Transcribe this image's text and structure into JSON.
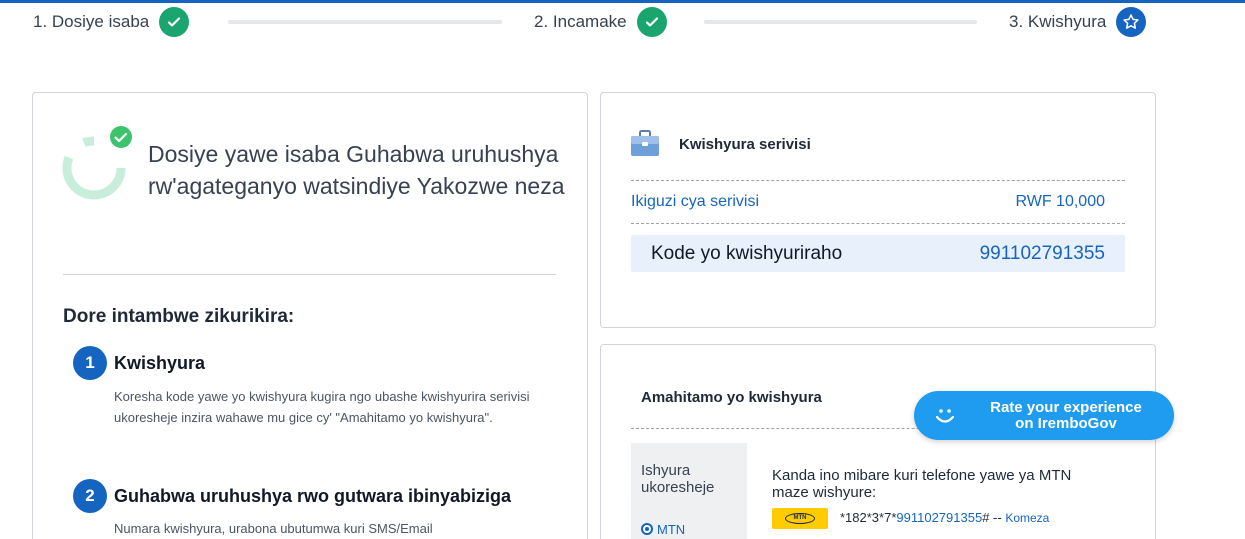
{
  "stepper": {
    "steps": [
      {
        "label": "1. Dosiye isaba",
        "status": "completed",
        "icon": "check-icon"
      },
      {
        "label": "2. Incamake",
        "status": "completed",
        "icon": "check-icon"
      },
      {
        "label": "3. Kwishyura",
        "status": "current",
        "icon": "star-icon"
      }
    ]
  },
  "success": {
    "title": "Dosiye yawe isaba Guhabwa uruhushya rw'agateganyo watsindiye Yakozwe neza",
    "icon": "success-check-icon"
  },
  "next_steps": {
    "heading": "Dore intambwe zikurikira:",
    "items": [
      {
        "number": "1",
        "title": "Kwishyura",
        "description": "Koresha kode yawe yo kwishyura kugira ngo ubashe kwishyurira serivisi ukoresheje inzira wahawe mu gice cy' \"Amahitamo yo kwishyura\"."
      },
      {
        "number": "2",
        "title": "Guhabwa uruhushya rwo gutwara ibinyabiziga",
        "description": "Numara kwishyura, urabona ubutumwa kuri SMS/Email"
      }
    ]
  },
  "payment": {
    "heading": "Kwishyura serivisi",
    "icon": "briefcase-icon",
    "fee_label": "Ikiguzi cya serivisi",
    "fee_value": "RWF 10,000",
    "code_label": "Kode yo kwishyuriraho",
    "code_value": "991102791355"
  },
  "payment_options": {
    "heading": "Amahitamo yo kwishyura",
    "method_label": "Ishyura ukoresheje",
    "selected_method": "MTN",
    "instruction": "Kanda ino mibare kuri telefone yawe ya MTN maze wishyure:",
    "logo_text": "MTN",
    "ussd_prefix": "*182*3*7*",
    "ussd_code": "991102791355",
    "ussd_suffix": "# --",
    "copy_label": "Komeza"
  },
  "rate_button": {
    "line1": "Rate your experience",
    "line2": "on IremboGov",
    "icon": "smiley-icon"
  },
  "colors": {
    "primary": "#1565c0",
    "success": "#1aa56f",
    "rate_button": "#1f9bef",
    "code_box": "#e8f0fb"
  }
}
